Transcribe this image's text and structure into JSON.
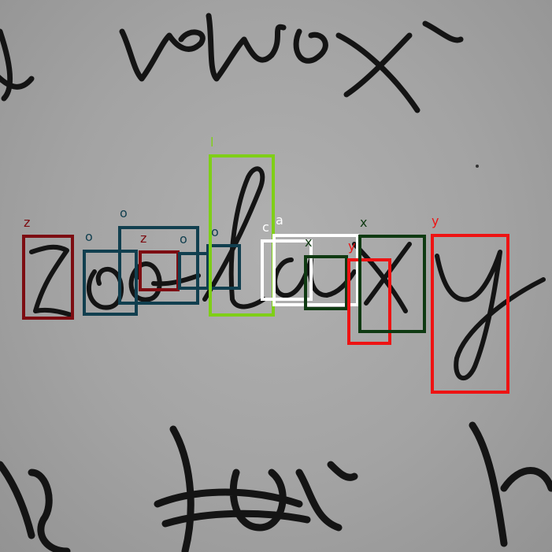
{
  "image": {
    "description_free": true
  },
  "annotations": {
    "colors": {
      "dark_red": "#7d0d12",
      "teal": "#113f4f",
      "lime": "#7fcf17",
      "white": "#ffffff",
      "dark_green": "#0f3a12",
      "red": "#ee1313"
    },
    "boxes": [
      {
        "label": "z",
        "color": "dark_red"
      },
      {
        "label": "o",
        "color": "teal"
      },
      {
        "label": "o",
        "color": "teal"
      },
      {
        "label": "z",
        "color": "dark_red"
      },
      {
        "label": "o",
        "color": "teal"
      },
      {
        "label": "o",
        "color": "teal"
      },
      {
        "label": "l",
        "color": "lime"
      },
      {
        "label": "c",
        "color": "white"
      },
      {
        "label": "a",
        "color": "white"
      },
      {
        "label": "x",
        "color": "dark_green"
      },
      {
        "label": "y",
        "color": "red"
      },
      {
        "label": "x",
        "color": "dark_green"
      },
      {
        "label": "y",
        "color": "red"
      }
    ]
  }
}
